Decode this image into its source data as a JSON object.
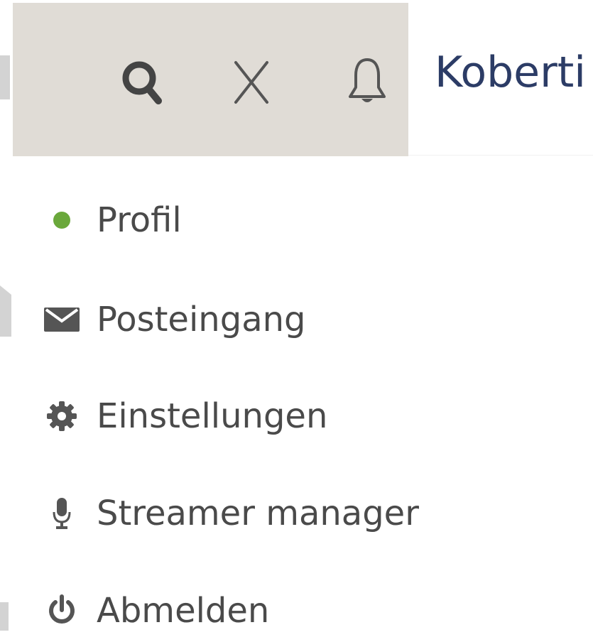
{
  "header": {
    "username": "Koberti",
    "icons": {
      "search": "search-icon",
      "close": "close-icon",
      "notifications": "bell-icon"
    }
  },
  "menu": {
    "items": [
      {
        "label": "Profil",
        "icon": "status-dot-icon",
        "status_color": "#6aa83b"
      },
      {
        "label": "Posteingang",
        "icon": "envelope-icon"
      },
      {
        "label": "Einstellungen",
        "icon": "gear-icon"
      },
      {
        "label": "Streamer manager",
        "icon": "microphone-icon"
      },
      {
        "label": "Abmelden",
        "icon": "power-icon"
      }
    ]
  },
  "colors": {
    "toolbar_bg": "#e0dcd6",
    "icon": "#444444",
    "username": "#2c3c66",
    "menu_text": "#4a4a4a",
    "online": "#6aa83b"
  }
}
